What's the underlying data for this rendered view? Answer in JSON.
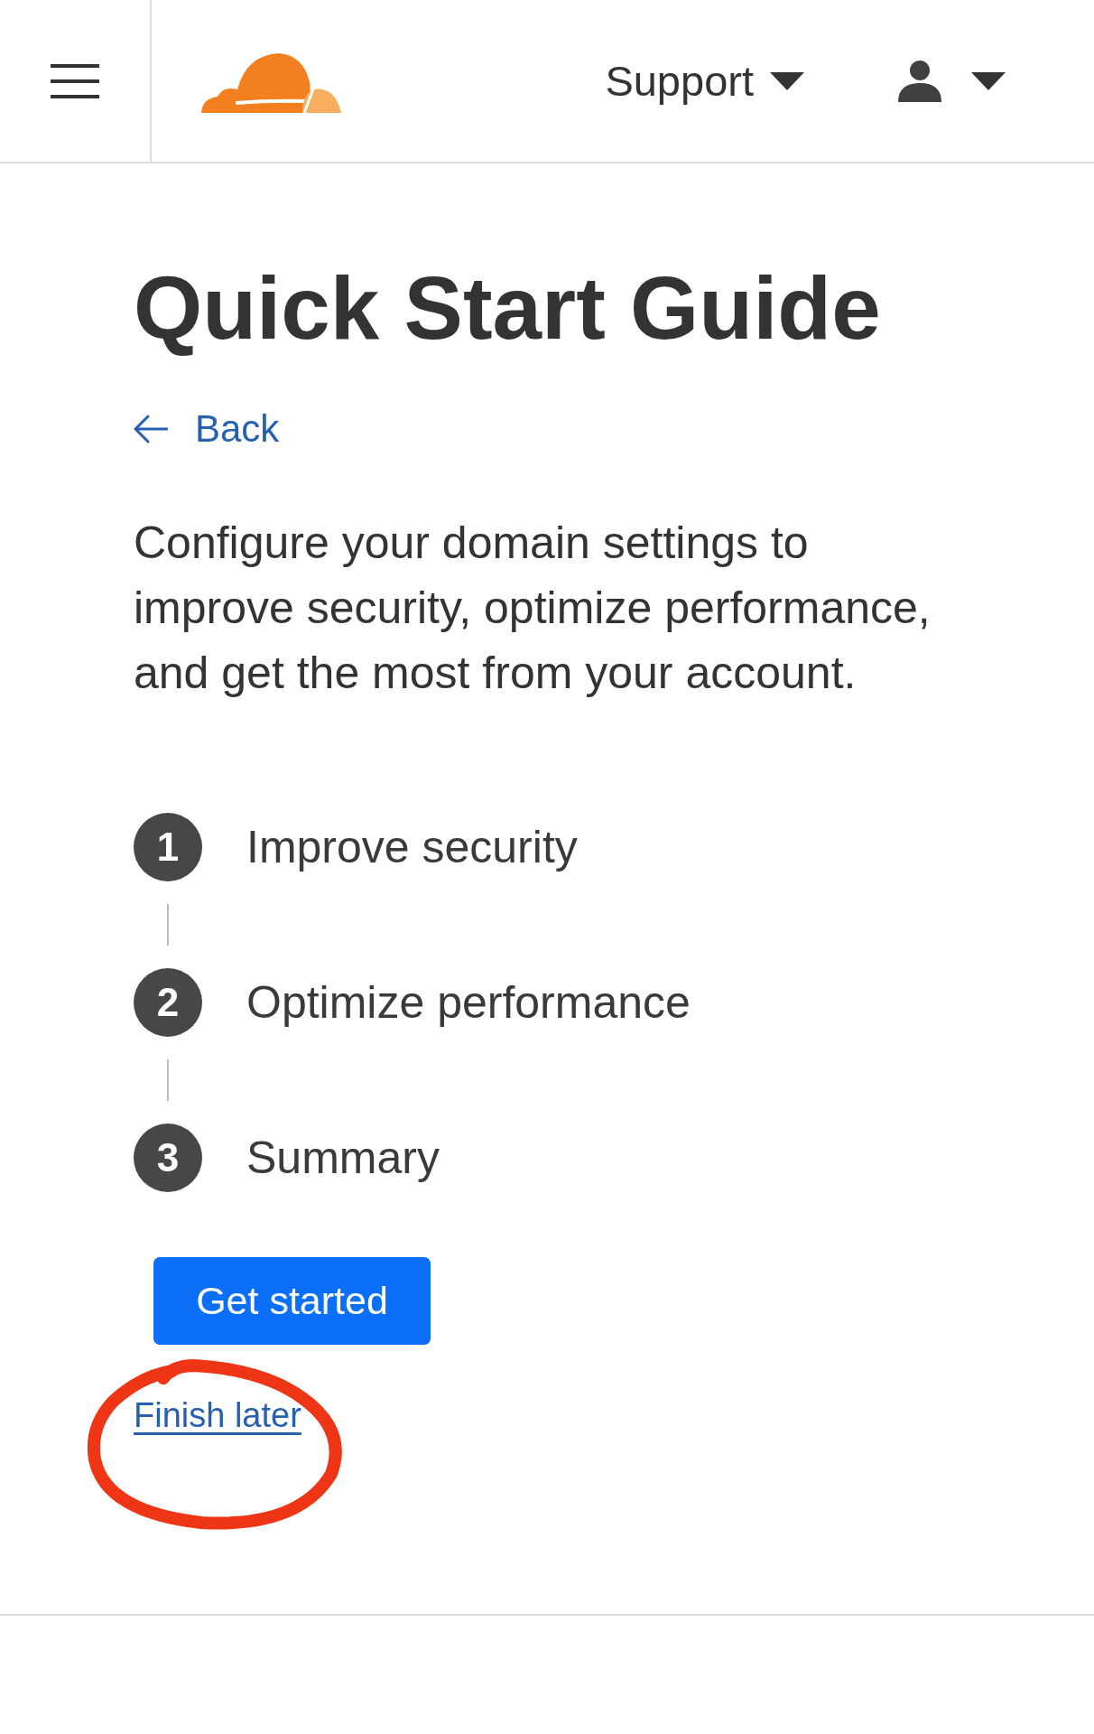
{
  "header": {
    "support_menu": {
      "label": "Support"
    }
  },
  "page": {
    "title": "Quick Start Guide",
    "back_link": {
      "label": "Back"
    },
    "description": "Configure your domain settings to improve security, optimize performance, and get the most from your account."
  },
  "steps": [
    {
      "number": "1",
      "label": "Improve security"
    },
    {
      "number": "2",
      "label": "Optimize performance"
    },
    {
      "number": "3",
      "label": "Summary"
    }
  ],
  "primary_button": {
    "label": "Get started"
  },
  "finish_later_link": {
    "label": "Finish later",
    "circled": true
  }
}
